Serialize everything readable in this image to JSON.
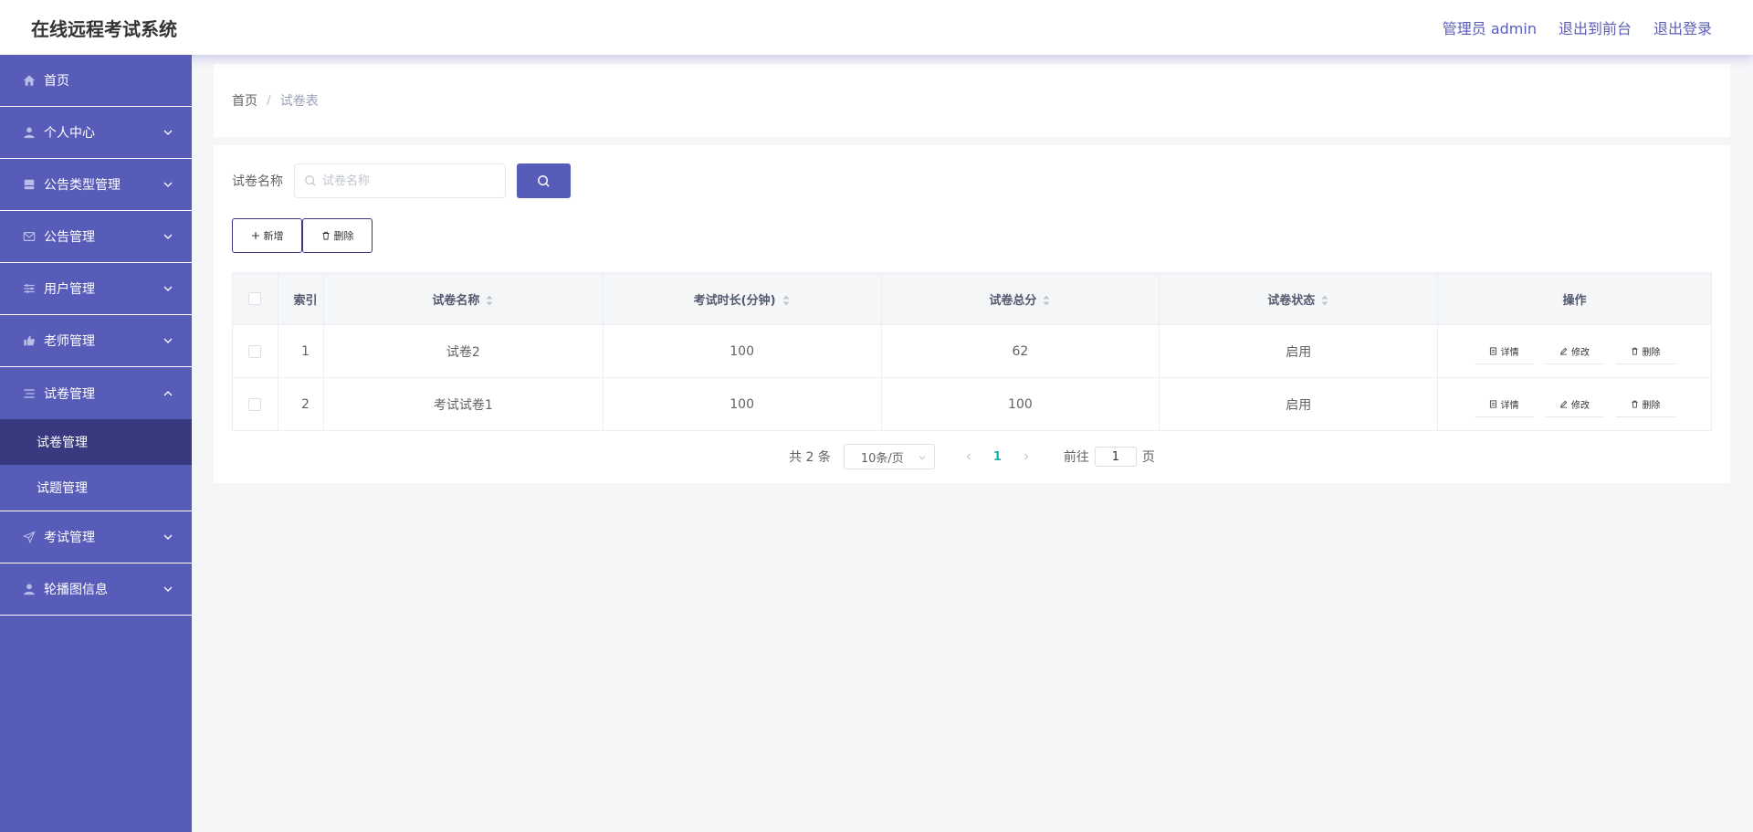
{
  "header": {
    "title": "在线远程考试系统",
    "user": "管理员 admin",
    "to_front": "退出到前台",
    "logout": "退出登录"
  },
  "sidebar": {
    "items": [
      {
        "label": "首页",
        "icon": "home-icon"
      },
      {
        "label": "个人中心",
        "icon": "user-icon"
      },
      {
        "label": "公告类型管理",
        "icon": "inbox-icon"
      },
      {
        "label": "公告管理",
        "icon": "mail-icon"
      },
      {
        "label": "用户管理",
        "icon": "sliders-icon"
      },
      {
        "label": "老师管理",
        "icon": "thumb-icon"
      },
      {
        "label": "试卷管理",
        "icon": "list-icon",
        "expanded": true,
        "children": [
          {
            "label": "试卷管理",
            "active": true
          },
          {
            "label": "试题管理",
            "active": false
          }
        ]
      },
      {
        "label": "考试管理",
        "icon": "send-icon"
      },
      {
        "label": "轮播图信息",
        "icon": "person-icon"
      }
    ]
  },
  "breadcrumb": {
    "home": "首页",
    "separator": "/",
    "current": "试卷表"
  },
  "search": {
    "label": "试卷名称",
    "placeholder": "试卷名称",
    "value": ""
  },
  "actions": {
    "add_label": "新增",
    "delete_label": "删除"
  },
  "table": {
    "headers": [
      "索引",
      "试卷名称",
      "考试时长(分钟)",
      "试卷总分",
      "试卷状态",
      "操作"
    ],
    "rows": [
      [
        "1",
        "试卷2",
        "100",
        "62",
        "启用"
      ],
      [
        "2",
        "考试试卷1",
        "100",
        "100",
        "启用"
      ]
    ],
    "row_actions": [
      "详情",
      "修改",
      "删除"
    ]
  },
  "pagination": {
    "total": "共 2 条",
    "page_size": "10条/页",
    "current_page": "1",
    "goto_prefix": "前往",
    "goto_value": "1",
    "goto_suffix": "页"
  },
  "colors": {
    "accent": "#585cb9",
    "active_sub": "#38397f",
    "page_current": "#17b3a3"
  }
}
